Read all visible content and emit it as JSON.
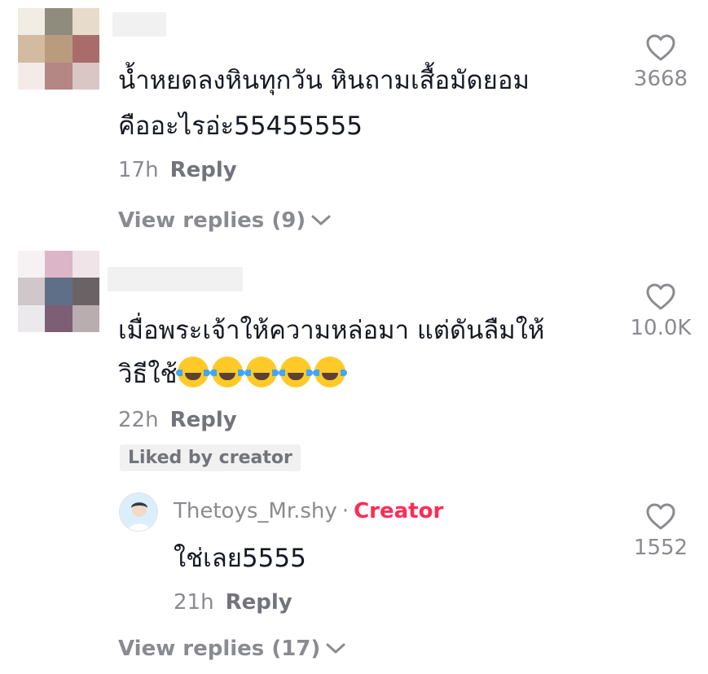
{
  "comments": [
    {
      "text_line1": "น้ำหยดลงหินทุกวัน หินถามเสื้อมัดยอม",
      "text_line2": "คืออะไรอ่ะ55455555",
      "time": "17h",
      "reply_label": "Reply",
      "likes": "3668",
      "view_replies": "View replies (9)"
    },
    {
      "text_line1": "เมื่อพระเจ้าให้ความหล่อมา แต่ดันลืมให้",
      "text_line2": "วิธีใช้",
      "time": "22h",
      "reply_label": "Reply",
      "likes": "10.0K",
      "badge": "Liked by creator",
      "reply": {
        "username": "Thetoys_Mr.shy",
        "separator": "·",
        "tag": "Creator",
        "text": "ใช่เลย5555",
        "time": "21h",
        "reply_label": "Reply",
        "likes": "1552"
      },
      "view_replies": "View replies (17)"
    }
  ],
  "icons": {
    "like": "heart-outline-icon",
    "expand": "chevron-down-icon",
    "emoji": "face-with-tears-of-joy-icon"
  },
  "colors": {
    "text": "#161823",
    "muted": "#8a8b91",
    "creator_tag": "#fe2c55",
    "badge_bg": "#f1f1f2"
  }
}
